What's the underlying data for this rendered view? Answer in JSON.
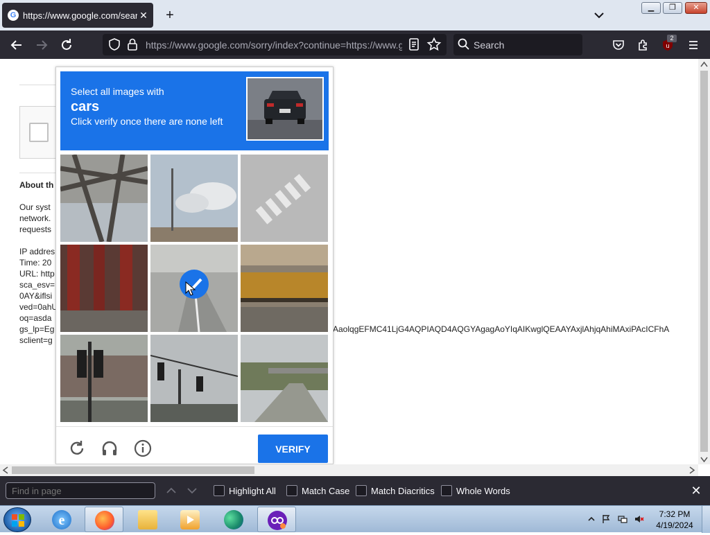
{
  "tab": {
    "title": "https://www.google.com/search",
    "favicon": "G",
    "close_glyph": "✕"
  },
  "new_tab_glyph": "+",
  "window": {
    "min": "▁",
    "max": "❐",
    "close": "✕"
  },
  "nav": {
    "url": "https://www.google.com/sorry/index?continue=https://www.g",
    "search_placeholder": "Search",
    "extension_badge": "2"
  },
  "page": {
    "about_heading": "About th",
    "body_lines": [
      "Our syst",
      "network.",
      "requests"
    ],
    "info_lines": [
      "IP addres",
      "Time: 20",
      "URL: http",
      "sca_esv=",
      "0AY&iflsi",
      "ved=0ahU",
      "oq=asda",
      "gs_lp=Eg",
      "sclient=g"
    ],
    "long_param": "AaolqgEFMC41LjG4AQPIAQD4AQGYAgagAoYIqAIKwglQEAAYAxjlAhjqAhiMAxiPAcICFhA"
  },
  "captcha": {
    "instruction": "Select all images with",
    "target": "cars",
    "subinstruction": "Click verify once there are none left",
    "verify_label": "VERIFY",
    "tiles": [
      {
        "subject": "bridge-girders",
        "selected": false
      },
      {
        "subject": "sky-clouds",
        "selected": false
      },
      {
        "subject": "crosswalk",
        "selected": false
      },
      {
        "subject": "red-building",
        "selected": false
      },
      {
        "subject": "road",
        "selected": true
      },
      {
        "subject": "stone-bridge",
        "selected": false
      },
      {
        "subject": "traffic-light",
        "selected": false
      },
      {
        "subject": "traffic-light-street",
        "selected": false
      },
      {
        "subject": "overpass-road",
        "selected": false
      }
    ]
  },
  "findbar": {
    "placeholder": "Find in page",
    "options": [
      "Highlight All",
      "Match Case",
      "Match Diacritics",
      "Whole Words"
    ],
    "close_glyph": "✕"
  },
  "taskbar": {
    "time": "7:32 PM",
    "date": "4/19/2024",
    "apps": [
      "internet-explorer",
      "firefox",
      "file-explorer",
      "media-player",
      "edge",
      "tor-browser"
    ]
  },
  "colors": {
    "accent": "#1a73e8",
    "chrome_dark": "#2b2a33",
    "field_dark": "#1c1b22"
  }
}
